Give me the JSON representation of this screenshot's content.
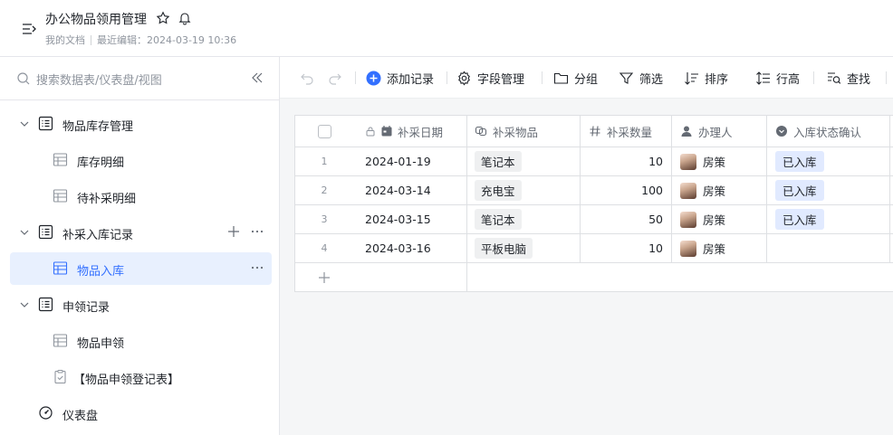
{
  "header": {
    "title": "办公物品领用管理",
    "breadcrumb": "我的文档",
    "last_edited": "最近编辑：2024-03-19 10:36"
  },
  "sidebar": {
    "search_placeholder": "搜索数据表/仪表盘/视图",
    "items": [
      {
        "label": "物品库存管理",
        "type": "group",
        "icon": "document-list-icon"
      },
      {
        "label": "库存明细",
        "type": "table",
        "icon": "table-icon"
      },
      {
        "label": "待补采明细",
        "type": "table",
        "icon": "table-icon"
      },
      {
        "label": "补采入库记录",
        "type": "group",
        "icon": "document-list-icon"
      },
      {
        "label": "物品入库",
        "type": "table",
        "icon": "table-icon",
        "active": true
      },
      {
        "label": "申领记录",
        "type": "group",
        "icon": "document-list-icon"
      },
      {
        "label": "物品申领",
        "type": "table",
        "icon": "table-icon"
      },
      {
        "label": "【物品申领登记表】",
        "type": "form",
        "icon": "clipboard-check-icon"
      },
      {
        "label": "仪表盘",
        "type": "dashboard",
        "icon": "dashboard-icon"
      }
    ]
  },
  "toolbar": {
    "add_record": "添加记录",
    "field_manage": "字段管理",
    "group": "分组",
    "filter": "筛选",
    "sort": "排序",
    "row_height": "行高",
    "find": "查找"
  },
  "table": {
    "columns": [
      "补采日期",
      "补采物品",
      "补采数量",
      "办理人",
      "入库状态确认"
    ],
    "rows": [
      {
        "num": "1",
        "date": "2024-01-19",
        "item": "笔记本",
        "qty": "10",
        "person": "房策",
        "status": "已入库"
      },
      {
        "num": "2",
        "date": "2024-03-14",
        "item": "充电宝",
        "qty": "100",
        "person": "房策",
        "status": "已入库"
      },
      {
        "num": "3",
        "date": "2024-03-15",
        "item": "笔记本",
        "qty": "50",
        "person": "房策",
        "status": "已入库"
      },
      {
        "num": "4",
        "date": "2024-03-16",
        "item": "平板电脑",
        "qty": "10",
        "person": "房策",
        "status": ""
      }
    ]
  },
  "colors": {
    "accent": "#3370ff",
    "active_bg": "#e8f0fe",
    "status_chip": "#e1eaff",
    "item_chip": "#eff0f1"
  }
}
